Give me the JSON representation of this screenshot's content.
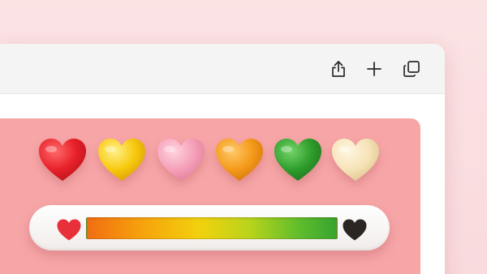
{
  "toolbar": {
    "buttons": [
      {
        "icon": "share-icon"
      },
      {
        "icon": "plus-icon"
      },
      {
        "icon": "tabs-overview-icon"
      }
    ]
  },
  "heart_swatches": [
    {
      "color": "red",
      "hex": "#e8202a"
    },
    {
      "color": "yellow",
      "hex": "#f7c90e"
    },
    {
      "color": "pink",
      "hex": "#f5a0b8"
    },
    {
      "color": "orange",
      "hex": "#f49a1a"
    },
    {
      "color": "green",
      "hex": "#2f9e2c"
    },
    {
      "color": "cream",
      "hex": "#f6e3b8"
    }
  ],
  "rating_bar": {
    "left_icon": "heart-icon",
    "left_color": "#e8303a",
    "right_icon": "heart-icon",
    "right_color": "#2b2624",
    "gradient_colors": [
      "#f26d12",
      "#f6a20c",
      "#f2d10d",
      "#b9d41b",
      "#5fbd2c",
      "#37a42f"
    ]
  }
}
